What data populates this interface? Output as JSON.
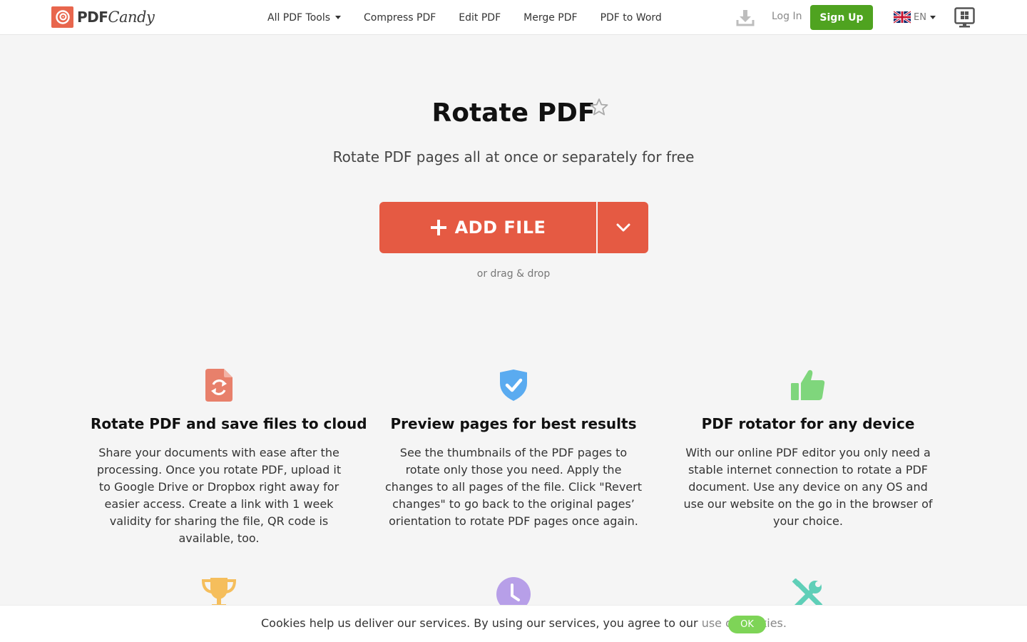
{
  "header": {
    "logo_pdf": "PDF",
    "logo_candy": "Candy",
    "nav": [
      {
        "label": "All PDF Tools"
      },
      {
        "label": "Compress PDF"
      },
      {
        "label": "Edit PDF"
      },
      {
        "label": "Merge PDF"
      },
      {
        "label": "PDF to Word"
      }
    ],
    "login": "Log In",
    "signup": "Sign Up",
    "language": "EN",
    "icons": [
      "download-icon",
      "uk-flag-icon",
      "windows-desktop-icon"
    ]
  },
  "hero": {
    "title": "Rotate PDF",
    "subtitle": "Rotate PDF pages all at once or separately for free",
    "add_file": "ADD FILE",
    "drag_hint": "or drag & drop",
    "icons": [
      "star-icon",
      "plus-icon",
      "chevron-down-icon"
    ]
  },
  "features": [
    {
      "icon": "file-rotate-icon",
      "color": "#e8806b",
      "title": "Rotate PDF and save files to cloud",
      "desc": "Share your documents with ease after the processing. Once you rotate PDF, upload it to Google Drive or Dropbox right away for easier access. Create a link with 1 week validity for sharing the file, QR code is available, too."
    },
    {
      "icon": "shield-check-icon",
      "color": "#5aabf0",
      "title": "Preview pages for best results",
      "desc": "See the thumbnails of the PDF pages to rotate only those you need. Apply the changes to all pages of the file. Click \"Revert changes\" to go back to the original pages’ orientation to rotate PDF pages once again."
    },
    {
      "icon": "thumbs-up-icon",
      "color": "#7fd67c",
      "title": "PDF rotator for any device",
      "desc": "With our online PDF editor you only need a stable internet connection to rotate a PDF document. Use any device on any OS and use our website on the go in the browser of your choice."
    }
  ],
  "more_feature_icons": [
    {
      "icon": "trophy-icon",
      "color": "#f5be5c"
    },
    {
      "icon": "clock-icon",
      "color": "#b79fe8"
    },
    {
      "icon": "tools-icon",
      "color": "#5fcfb8"
    }
  ],
  "cookie": {
    "text": "Cookies help us deliver our services. By using our services, you agree to our ",
    "link": "use of cookies.",
    "ok": "OK"
  },
  "colors": {
    "accent": "#e55a43",
    "signup": "#4fa320",
    "cookie_ok": "#7ed457"
  }
}
